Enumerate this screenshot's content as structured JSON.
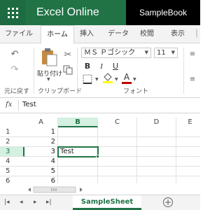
{
  "app": {
    "name": "Excel Online",
    "workbook": "SampleBook"
  },
  "tabs": [
    {
      "label": "ファイル"
    },
    {
      "label": "ホーム"
    },
    {
      "label": "挿入"
    },
    {
      "label": "データ"
    },
    {
      "label": "校閲"
    },
    {
      "label": "表示"
    }
  ],
  "ribbon": {
    "undo_group_label": "元に戻す",
    "clipboard_group_label": "クリップボード",
    "paste_label": "貼り付け",
    "font_group_label": "フォント",
    "font_name": "ＭＳ Ｐゴシック",
    "font_size": "11",
    "bold": "B",
    "italic": "I",
    "underline": "U",
    "font_color_letter": "A",
    "accent_color": "#217346"
  },
  "formula_bar": {
    "fx_label": "fx",
    "value": "Test"
  },
  "grid": {
    "columns": [
      "A",
      "B",
      "C",
      "D",
      "E"
    ],
    "selected_column": "B",
    "rows": [
      {
        "num": "1",
        "a": "1",
        "b": ""
      },
      {
        "num": "2",
        "a": "2",
        "b": ""
      },
      {
        "num": "3",
        "a": "3",
        "b": "Test"
      },
      {
        "num": "4",
        "a": "4",
        "b": ""
      },
      {
        "num": "5",
        "a": "5",
        "b": ""
      },
      {
        "num": "6",
        "a": "6",
        "b": ""
      }
    ],
    "selected_row": "3"
  },
  "sheets": {
    "active": "SampleSheet",
    "add_label": "+"
  }
}
